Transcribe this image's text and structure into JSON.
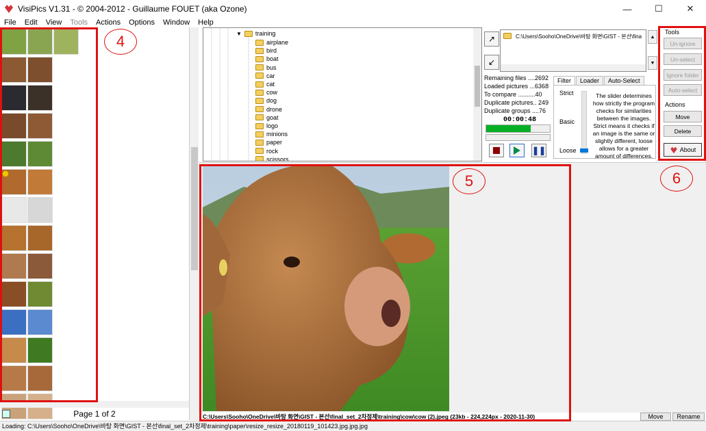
{
  "window": {
    "title": "VisiPics V1.31 - © 2004-2012 - Guillaume FOUET (aka Ozone)",
    "minimize": "—",
    "maximize": "☐",
    "close": "✕"
  },
  "menu": [
    {
      "label": "File",
      "disabled": false
    },
    {
      "label": "Edit",
      "disabled": false
    },
    {
      "label": "View",
      "disabled": false
    },
    {
      "label": "Tools",
      "disabled": true
    },
    {
      "label": "Actions",
      "disabled": false
    },
    {
      "label": "Options",
      "disabled": false
    },
    {
      "label": "Window",
      "disabled": false
    },
    {
      "label": "Help",
      "disabled": false
    }
  ],
  "thumbnails": {
    "rows": [
      [
        "#7fa343",
        "#8aa552",
        "#9fb35f"
      ],
      [
        "#8b5a34",
        "#7e4f2e"
      ],
      [
        "#2a2a30",
        "#3b3128"
      ],
      [
        "#7a4a2c",
        "#8e5a36"
      ],
      [
        "#4d7a2f",
        "#5f8a35"
      ],
      [
        "#b06a2e",
        "#c27a38"
      ],
      [
        "#e8e8e8",
        "#d7d7d7"
      ],
      [
        "#b5732f",
        "#a8672a"
      ],
      [
        "#b07a50",
        "#8a5a3a"
      ],
      [
        "#8a4e26",
        "#6f8a33"
      ],
      [
        "#3b6fc2",
        "#5b8ad0"
      ],
      [
        "#c68a4a",
        "#3f7a22"
      ],
      [
        "#b67a48",
        "#a8693a"
      ],
      [
        "#c9a27a",
        "#d6b08a"
      ]
    ],
    "page_label": "Page 1 of 2"
  },
  "tree": {
    "root": "training",
    "items": [
      "airplane",
      "bird",
      "boat",
      "bus",
      "car",
      "cat",
      "cow",
      "dog",
      "drone",
      "goat",
      "logo",
      "minions",
      "paper",
      "rock",
      "scissors"
    ]
  },
  "path": {
    "text": "C:\\Users\\Sooho\\OneDrive\\바탕 화면\\GIST - 본선\\fina"
  },
  "stats": [
    "Remaining files ....2692",
    "Loaded pictures ...6368",
    "To compare ..........40",
    "Duplicate pictures.. 249",
    "Duplicate groups ....76"
  ],
  "timer": "00:00:48",
  "progress_fraction": 0.7,
  "tabs": [
    "Filter",
    "Loader",
    "Auto-Select"
  ],
  "filter": {
    "strict": "Strict",
    "basic": "Basic",
    "loose": "Loose",
    "slider_level": "Loose",
    "description": "The slider determines how strictly the program checks for similarities between the images. Strict means it checks if an image is the same or slightly different, loose allows for a greater amount of differences."
  },
  "tools": {
    "tools_label": "Tools",
    "unignore": "Un-ignore",
    "unselect": "Un-select",
    "ignore_folder": "Ignore folder",
    "auto_select": "Auto-select",
    "actions_label": "Actions",
    "move": "Move",
    "delete": "Delete",
    "about": "About"
  },
  "preview": {
    "caption": "C:\\Users\\Sooho\\OneDrive\\바탕 화면\\GIST - 본선\\final_set_2차정제\\training\\cow\\cow (2).jpeg (23kb - 224,224px - 2020-11-30)",
    "move": "Move",
    "rename": "Rename"
  },
  "status": "Loading: C:\\Users\\Sooho\\OneDrive\\바탕 화면\\GIST - 본선\\final_set_2차정제\\training\\paper\\resize_resize_20180119_101423.jpg.jpg.jpg",
  "annotations": [
    "4",
    "5",
    "6"
  ],
  "colors": {
    "annotation_red": "#e01010",
    "progress_green": "#06b025",
    "folder_yellow": "#f5cf5c"
  }
}
